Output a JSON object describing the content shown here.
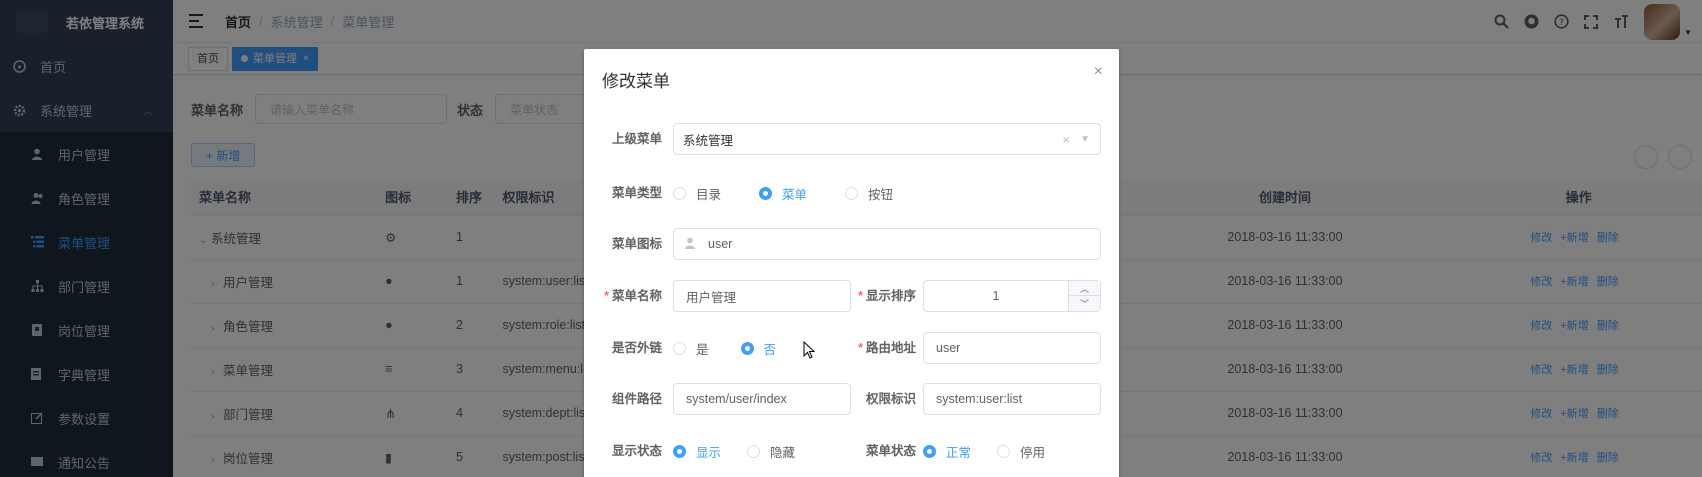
{
  "app_title": "若依管理系统",
  "sidebar": {
    "home": "首页",
    "system": "系统管理",
    "items": [
      {
        "label": "用户管理",
        "icon": "user-icon"
      },
      {
        "label": "角色管理",
        "icon": "peoples-icon"
      },
      {
        "label": "菜单管理",
        "icon": "tree-table-icon"
      },
      {
        "label": "部门管理",
        "icon": "tree-icon"
      },
      {
        "label": "岗位管理",
        "icon": "post-icon"
      },
      {
        "label": "字典管理",
        "icon": "dict-icon"
      },
      {
        "label": "参数设置",
        "icon": "edit-icon"
      },
      {
        "label": "通知公告",
        "icon": "message-icon"
      }
    ]
  },
  "breadcrumb": [
    "首页",
    "系统管理",
    "菜单管理"
  ],
  "tags": [
    {
      "label": "首页",
      "active": false
    },
    {
      "label": "菜单管理",
      "active": true,
      "close": "×"
    }
  ],
  "search": {
    "name_label": "菜单名称",
    "name_placeholder": "请输入菜单名称",
    "status_label": "状态",
    "status_placeholder": "菜单状态"
  },
  "add_button": "+ 新增",
  "table": {
    "headers": [
      "菜单名称",
      "图标",
      "排序",
      "权限标识",
      "创建时间",
      "操作"
    ],
    "rows": [
      {
        "arrow": "⌄",
        "name": "系统管理",
        "order": "1",
        "perm": "",
        "time": "2018-03-16 11:33:00"
      },
      {
        "arrow": "›",
        "name": "用户管理",
        "order": "1",
        "perm": "system:user:list",
        "time": "2018-03-16 11:33:00"
      },
      {
        "arrow": "›",
        "name": "角色管理",
        "order": "2",
        "perm": "system:role:list",
        "time": "2018-03-16 11:33:00"
      },
      {
        "arrow": "›",
        "name": "菜单管理",
        "order": "3",
        "perm": "system:menu:list",
        "time": "2018-03-16 11:33:00"
      },
      {
        "arrow": "›",
        "name": "部门管理",
        "order": "4",
        "perm": "system:dept:list",
        "time": "2018-03-16 11:33:00"
      },
      {
        "arrow": "›",
        "name": "岗位管理",
        "order": "5",
        "perm": "system:post:list",
        "time": "2018-03-16 11:33:00"
      }
    ],
    "ops": [
      "修改",
      "+新增",
      "删除"
    ]
  },
  "dialog": {
    "title": "修改菜单",
    "close": "×",
    "parent_label": "上级菜单",
    "parent_value": "系统管理",
    "type_label": "菜单类型",
    "type_options": [
      "目录",
      "菜单",
      "按钮"
    ],
    "icon_label": "菜单图标",
    "icon_value": "user",
    "name_label": "菜单名称",
    "name_value": "用户管理",
    "order_label": "显示排序",
    "order_value": "1",
    "external_label": "是否外链",
    "external_options": [
      "是",
      "否"
    ],
    "path_label": "路由地址",
    "path_value": "user",
    "component_label": "组件路径",
    "component_value": "system/user/index",
    "perm_label": "权限标识",
    "perm_value": "system:user:list",
    "visible_label": "显示状态",
    "visible_options": [
      "显示",
      "隐藏"
    ],
    "status_label": "菜单状态",
    "status_options": [
      "正常",
      "停用"
    ]
  },
  "colors": {
    "sidebar_bg": "#304156",
    "accent": "#409eff"
  }
}
